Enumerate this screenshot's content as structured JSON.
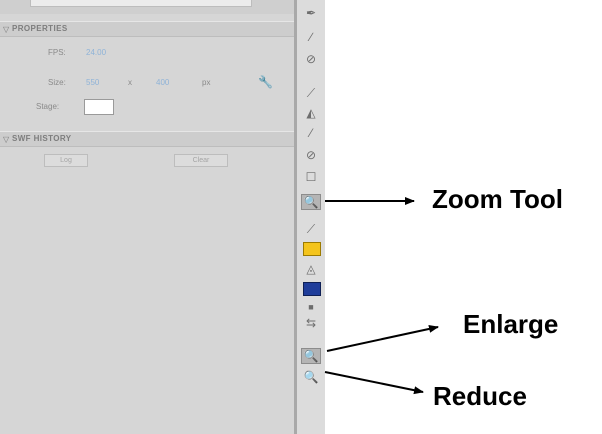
{
  "properties_panel": {
    "header_properties": "PROPERTIES",
    "fps_label": "FPS:",
    "fps_value": "24.00",
    "size_label": "Size:",
    "width_value": "550",
    "x_label": "x",
    "height_value": "400",
    "unit": "px",
    "stage_label": "Stage:",
    "header_swf_history": "SWF HISTORY",
    "log_button": "Log",
    "clear_button": "Clear"
  },
  "toolbar": {
    "icons": [
      "pen-tool-icon",
      "brush-tool-icon",
      "deco-tool-icon",
      "bone-tool-icon",
      "paint-bucket-icon",
      "eyedropper-icon",
      "eraser-icon",
      "hand-tool-icon",
      "zoom-tool-icon",
      "stroke-color-icon",
      "fill-color-icon",
      "black-white-icon",
      "swap-colors-icon",
      "enlarge-icon",
      "reduce-icon"
    ],
    "stroke_color": "#f4c41c",
    "fill_color": "#1f3d9a"
  },
  "callouts": {
    "zoom_tool": "Zoom Tool",
    "enlarge": "Enlarge",
    "reduce": "Reduce"
  }
}
